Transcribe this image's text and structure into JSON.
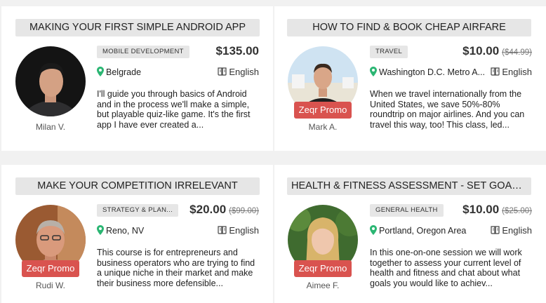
{
  "cards": [
    {
      "title": "MAKING YOUR FIRST SIMPLE ANDROID APP",
      "category": "MOBILE DEVELOPMENT",
      "price": "$135.00",
      "old_price": "",
      "location": "Belgrade",
      "language": "English",
      "description": "I'll guide you through basics of Android and in the process we'll make a simple, but playable quiz-like game. It's the first app I have ever created a...",
      "tutor": "Milan V.",
      "promo": ""
    },
    {
      "title": "HOW TO FIND & BOOK CHEAP AIRFARE",
      "category": "TRAVEL",
      "price": "$10.00",
      "old_price": "($44.99)",
      "location": "Washington D.C. Metro A...",
      "language": "English",
      "description": "When we travel internationally from the United States, we save 50%-80% roundtrip on major airlines. And you can travel this way, too! This class, led...",
      "tutor": "Mark A.",
      "promo": "Zeqr Promo"
    },
    {
      "title": "MAKE YOUR COMPETITION IRRELEVANT",
      "category": "STRATEGY & PLAN...",
      "price": "$20.00",
      "old_price": "($99.00)",
      "location": "Reno, NV",
      "language": "English",
      "description": "This course is for entrepreneurs and business operators who are trying to find a unique niche in their market and make their business more defensible...",
      "tutor": "Rudi W.",
      "promo": "Zeqr Promo"
    },
    {
      "title": "HEALTH & FITNESS ASSESSMENT - SET GOALS AN...",
      "category": "GENERAL HEALTH",
      "price": "$10.00",
      "old_price": "($25.00)",
      "location": "Portland, Oregon Area",
      "language": "English",
      "description": "In this one-on-one session we will work together to assess your current level of health and fitness and chat about what goals you would like to achiev...",
      "tutor": "Aimee F.",
      "promo": "Zeqr Promo"
    }
  ],
  "colors": {
    "promo": "#d9534f",
    "pin": "#2bb673",
    "tag_bg": "#e6e6e6"
  },
  "icons": {
    "location": "map-pin-icon",
    "language": "book-icon"
  }
}
